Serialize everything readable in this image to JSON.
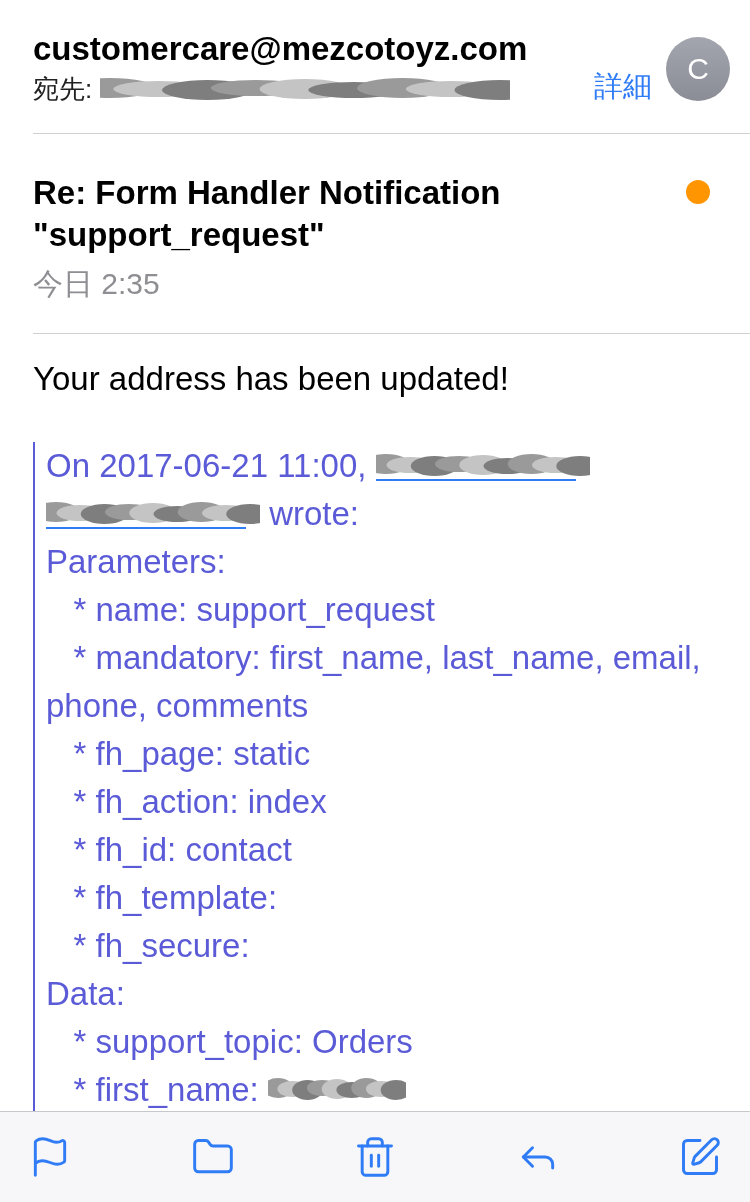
{
  "header": {
    "sender": "customercare@mezcotoyz.com",
    "to_label": "宛先:",
    "details_link": "詳細",
    "avatar_letter": "C"
  },
  "message": {
    "subject": "Re: Form Handler Notification \"support_request\"",
    "unread": true,
    "date": "今日 2:35"
  },
  "body": {
    "intro": "Your address has been updated!",
    "quote": [
      [
        {
          "kind": "text",
          "text": "On 2017-06-21 11:00, "
        },
        {
          "kind": "redacted_link"
        }
      ],
      [
        {
          "kind": "redacted_link"
        },
        {
          "kind": "text",
          "text": " wrote:"
        }
      ],
      [
        {
          "kind": "text",
          "text": "Parameters:"
        }
      ],
      [
        {
          "kind": "text",
          "text": "   * name: support_request"
        }
      ],
      [
        {
          "kind": "text",
          "text": "   * mandatory: first_name, last_name, email,"
        }
      ],
      [
        {
          "kind": "text",
          "text": "phone, comments"
        }
      ],
      [
        {
          "kind": "text",
          "text": "   * fh_page: static"
        }
      ],
      [
        {
          "kind": "text",
          "text": "   * fh_action: index"
        }
      ],
      [
        {
          "kind": "text",
          "text": "   * fh_id: contact"
        }
      ],
      [
        {
          "kind": "text",
          "text": "   * fh_template:"
        }
      ],
      [
        {
          "kind": "text",
          "text": "   * fh_secure:"
        }
      ],
      [
        {
          "kind": "text",
          "text": "Data:"
        }
      ],
      [
        {
          "kind": "text",
          "text": "   * support_topic: Orders"
        }
      ],
      [
        {
          "kind": "text",
          "text": "   * first_name: "
        },
        {
          "kind": "redacted"
        }
      ]
    ]
  },
  "toolbar": [
    {
      "kind": "flag"
    },
    {
      "kind": "folder"
    },
    {
      "kind": "trash"
    },
    {
      "kind": "reply"
    },
    {
      "kind": "compose"
    }
  ]
}
